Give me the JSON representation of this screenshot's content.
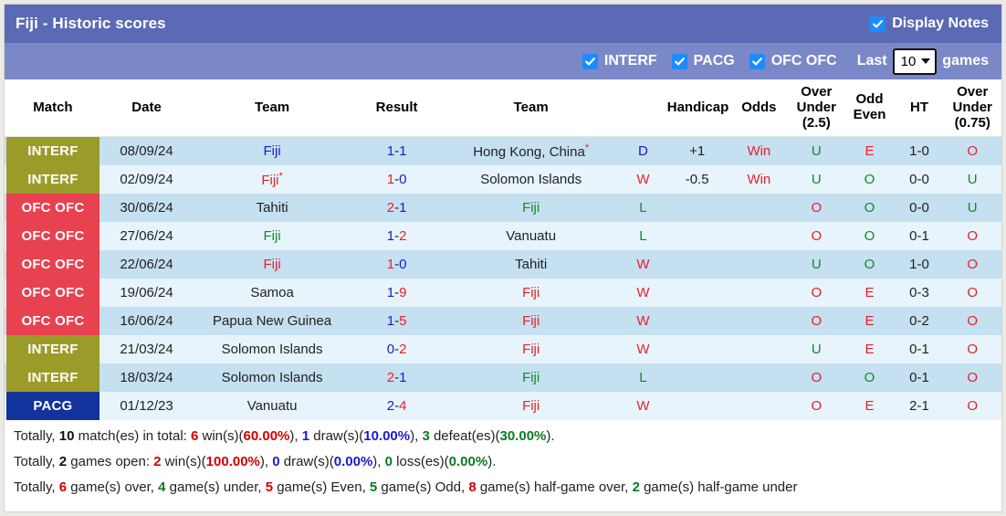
{
  "header": {
    "title": "Fiji - Historic scores",
    "display_notes_label": "Display Notes",
    "display_notes_checked": true,
    "filters": [
      {
        "label": "INTERF",
        "checked": true
      },
      {
        "label": "PACG",
        "checked": true
      },
      {
        "label": "OFC OFC",
        "checked": true
      }
    ],
    "last_label": "Last",
    "last_value": "10",
    "games_label": "games",
    "colors": {
      "title_bar": "#5a6ab4",
      "filter_bar": "#7b88c8",
      "checkbox": "#1a8cff"
    }
  },
  "table": {
    "columns": [
      "Match",
      "Date",
      "Team",
      "Result",
      "Team",
      "Handicap",
      "Odds",
      "Over\nUnder\n(2.5)",
      "Odd\nEven",
      "HT",
      "Over\nUnder\n(0.75)"
    ],
    "columns_display": [
      {
        "line1": "Match",
        "line2": "",
        "line3": ""
      },
      {
        "line1": "Date",
        "line2": "",
        "line3": ""
      },
      {
        "line1": "Team",
        "line2": "",
        "line3": ""
      },
      {
        "line1": "Result",
        "line2": "",
        "line3": ""
      },
      {
        "line1": "Team",
        "line2": "",
        "line3": ""
      },
      {
        "line1": "Handicap",
        "line2": "",
        "line3": ""
      },
      {
        "line1": "Odds",
        "line2": "",
        "line3": ""
      },
      {
        "line1": "Over",
        "line2": "Under",
        "line3": "(2.5)"
      },
      {
        "line1": "Odd",
        "line2": "Even",
        "line3": ""
      },
      {
        "line1": "HT",
        "line2": "",
        "line3": ""
      },
      {
        "line1": "Over",
        "line2": "Under",
        "line3": "(0.75)"
      }
    ],
    "rows": [
      {
        "match": "INTERF",
        "match_class": "b-INTERF",
        "date": "08/09/24",
        "home": "Fiji",
        "home_color": "c-blue",
        "home_star": false,
        "score_home": "1",
        "score_home_color": "c-blue",
        "score_away": "1",
        "score_away_color": "c-blue",
        "away": "Hong Kong, China",
        "away_color": "c-dark",
        "away_star": true,
        "result": "D",
        "result_color": "c-blue",
        "handicap": "+1",
        "odds": "Win",
        "odds_color": "c-red",
        "ou25": "U",
        "ou25_color": "c-green",
        "oe": "E",
        "oe_color": "c-red",
        "ht": "1-0",
        "ou075": "O",
        "ou075_color": "c-red"
      },
      {
        "match": "INTERF",
        "match_class": "b-INTERF",
        "date": "02/09/24",
        "home": "Fiji",
        "home_color": "c-red",
        "home_star": true,
        "score_home": "1",
        "score_home_color": "c-red",
        "score_away": "0",
        "score_away_color": "c-blue",
        "away": "Solomon Islands",
        "away_color": "c-dark",
        "away_star": false,
        "result": "W",
        "result_color": "c-red",
        "handicap": "-0.5",
        "odds": "Win",
        "odds_color": "c-red",
        "ou25": "U",
        "ou25_color": "c-green",
        "oe": "O",
        "oe_color": "c-green",
        "ht": "0-0",
        "ou075": "U",
        "ou075_color": "c-green"
      },
      {
        "match": "OFC OFC",
        "match_class": "b-OFCOFC",
        "date": "30/06/24",
        "home": "Tahiti",
        "home_color": "c-dark",
        "home_star": false,
        "score_home": "2",
        "score_home_color": "c-red",
        "score_away": "1",
        "score_away_color": "c-blue",
        "away": "Fiji",
        "away_color": "c-green",
        "away_star": false,
        "result": "L",
        "result_color": "c-green",
        "handicap": "",
        "odds": "",
        "odds_color": "c-dark",
        "ou25": "O",
        "ou25_color": "c-red",
        "oe": "O",
        "oe_color": "c-green",
        "ht": "0-0",
        "ou075": "U",
        "ou075_color": "c-green"
      },
      {
        "match": "OFC OFC",
        "match_class": "b-OFCOFC",
        "date": "27/06/24",
        "home": "Fiji",
        "home_color": "c-green",
        "home_star": false,
        "score_home": "1",
        "score_home_color": "c-blue",
        "score_away": "2",
        "score_away_color": "c-red",
        "away": "Vanuatu",
        "away_color": "c-dark",
        "away_star": false,
        "result": "L",
        "result_color": "c-green",
        "handicap": "",
        "odds": "",
        "odds_color": "c-dark",
        "ou25": "O",
        "ou25_color": "c-red",
        "oe": "O",
        "oe_color": "c-green",
        "ht": "0-1",
        "ou075": "O",
        "ou075_color": "c-red"
      },
      {
        "match": "OFC OFC",
        "match_class": "b-OFCOFC",
        "date": "22/06/24",
        "home": "Fiji",
        "home_color": "c-red",
        "home_star": false,
        "score_home": "1",
        "score_home_color": "c-red",
        "score_away": "0",
        "score_away_color": "c-blue",
        "away": "Tahiti",
        "away_color": "c-dark",
        "away_star": false,
        "result": "W",
        "result_color": "c-red",
        "handicap": "",
        "odds": "",
        "odds_color": "c-dark",
        "ou25": "U",
        "ou25_color": "c-green",
        "oe": "O",
        "oe_color": "c-green",
        "ht": "1-0",
        "ou075": "O",
        "ou075_color": "c-red"
      },
      {
        "match": "OFC OFC",
        "match_class": "b-OFCOFC",
        "date": "19/06/24",
        "home": "Samoa",
        "home_color": "c-dark",
        "home_star": false,
        "score_home": "1",
        "score_home_color": "c-blue",
        "score_away": "9",
        "score_away_color": "c-red",
        "away": "Fiji",
        "away_color": "c-red",
        "away_star": false,
        "result": "W",
        "result_color": "c-red",
        "handicap": "",
        "odds": "",
        "odds_color": "c-dark",
        "ou25": "O",
        "ou25_color": "c-red",
        "oe": "E",
        "oe_color": "c-red",
        "ht": "0-3",
        "ou075": "O",
        "ou075_color": "c-red"
      },
      {
        "match": "OFC OFC",
        "match_class": "b-OFCOFC",
        "date": "16/06/24",
        "home": "Papua New Guinea",
        "home_color": "c-dark",
        "home_star": false,
        "score_home": "1",
        "score_home_color": "c-blue",
        "score_away": "5",
        "score_away_color": "c-red",
        "away": "Fiji",
        "away_color": "c-red",
        "away_star": false,
        "result": "W",
        "result_color": "c-red",
        "handicap": "",
        "odds": "",
        "odds_color": "c-dark",
        "ou25": "O",
        "ou25_color": "c-red",
        "oe": "E",
        "oe_color": "c-red",
        "ht": "0-2",
        "ou075": "O",
        "ou075_color": "c-red"
      },
      {
        "match": "INTERF",
        "match_class": "b-INTERF",
        "date": "21/03/24",
        "home": "Solomon Islands",
        "home_color": "c-dark",
        "home_star": false,
        "score_home": "0",
        "score_home_color": "c-blue",
        "score_away": "2",
        "score_away_color": "c-red",
        "away": "Fiji",
        "away_color": "c-red",
        "away_star": false,
        "result": "W",
        "result_color": "c-red",
        "handicap": "",
        "odds": "",
        "odds_color": "c-dark",
        "ou25": "U",
        "ou25_color": "c-green",
        "oe": "E",
        "oe_color": "c-red",
        "ht": "0-1",
        "ou075": "O",
        "ou075_color": "c-red"
      },
      {
        "match": "INTERF",
        "match_class": "b-INTERF",
        "date": "18/03/24",
        "home": "Solomon Islands",
        "home_color": "c-dark",
        "home_star": false,
        "score_home": "2",
        "score_home_color": "c-red",
        "score_away": "1",
        "score_away_color": "c-blue",
        "away": "Fiji",
        "away_color": "c-green",
        "away_star": false,
        "result": "L",
        "result_color": "c-green",
        "handicap": "",
        "odds": "",
        "odds_color": "c-dark",
        "ou25": "O",
        "ou25_color": "c-red",
        "oe": "O",
        "oe_color": "c-green",
        "ht": "0-1",
        "ou075": "O",
        "ou075_color": "c-red"
      },
      {
        "match": "PACG",
        "match_class": "b-PACG",
        "date": "01/12/23",
        "home": "Vanuatu",
        "home_color": "c-dark",
        "home_star": false,
        "score_home": "2",
        "score_home_color": "c-blue",
        "score_away": "4",
        "score_away_color": "c-red",
        "away": "Fiji",
        "away_color": "c-red",
        "away_star": false,
        "result": "W",
        "result_color": "c-red",
        "handicap": "",
        "odds": "",
        "odds_color": "c-dark",
        "ou25": "O",
        "ou25_color": "c-red",
        "oe": "E",
        "oe_color": "c-red",
        "ht": "2-1",
        "ou075": "O",
        "ou075_color": "c-red"
      }
    ]
  },
  "summary": {
    "line1": {
      "t1": "Totally, ",
      "n_total": "10",
      "t2": " match(es) in total: ",
      "n_win": "6",
      "t3": " win(s)(",
      "p_win": "60.00%",
      "t4": "), ",
      "n_draw": "1",
      "t5": " draw(s)(",
      "p_draw": "10.00%",
      "t6": "), ",
      "n_def": "3",
      "t7": " defeat(es)(",
      "p_def": "30.00%",
      "t8": ")."
    },
    "line2": {
      "t1": "Totally, ",
      "n_open": "2",
      "t2": " games open: ",
      "n_win": "2",
      "t3": " win(s)(",
      "p_win": "100.00%",
      "t4": "), ",
      "n_draw": "0",
      "t5": " draw(s)(",
      "p_draw": "0.00%",
      "t6": "), ",
      "n_loss": "0",
      "t7": " loss(es)(",
      "p_loss": "0.00%",
      "t8": ")."
    },
    "line3": {
      "t1": "Totally, ",
      "n_over": "6",
      "t2": " game(s) over, ",
      "n_under": "4",
      "t3": " game(s) under, ",
      "n_even": "5",
      "t4": " game(s) Even, ",
      "n_odd": "5",
      "t5": " game(s) Odd, ",
      "n_hover": "8",
      "t6": " game(s) half-game over, ",
      "n_hunder": "2",
      "t7": " game(s) half-game under"
    }
  }
}
